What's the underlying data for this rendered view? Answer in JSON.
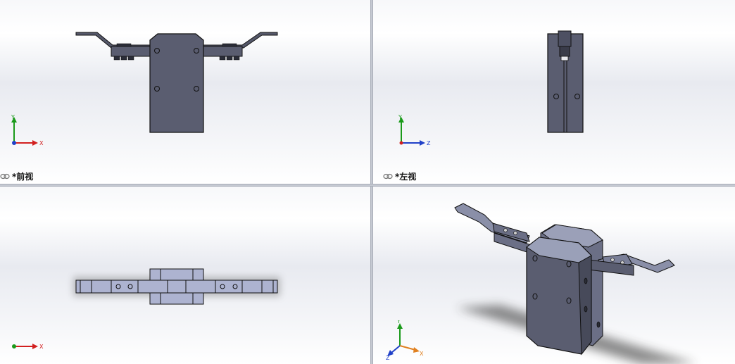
{
  "toolbar": {
    "items": [
      {
        "icon": "zoom-to-fit-icon",
        "dropdown": false
      },
      {
        "icon": "zoom-to-area-icon",
        "dropdown": false
      },
      {
        "icon": "previous-view-icon",
        "dropdown": false
      },
      {
        "icon": "section-view-icon",
        "dropdown": false
      },
      {
        "icon": "view-orientation-icon",
        "dropdown": true
      },
      {
        "icon": "display-style-icon",
        "dropdown": true
      },
      {
        "icon": "hide-show-items-icon",
        "dropdown": true
      },
      {
        "icon": "edit-appearance-icon",
        "dropdown": false
      },
      {
        "icon": "apply-scene-icon",
        "dropdown": true
      },
      {
        "icon": "view-settings-icon",
        "dropdown": true
      }
    ]
  },
  "viewports": {
    "front": {
      "label": "*前视",
      "triad": {
        "x": "X",
        "y": "Y"
      }
    },
    "left": {
      "label": "*左视",
      "triad": {
        "y": "Y",
        "z": "Z"
      }
    },
    "top": {
      "label": "",
      "triad": {
        "x": "X"
      }
    },
    "iso": {
      "label": "",
      "triad": {
        "x": "X",
        "y": "Y",
        "z": "Z"
      }
    }
  },
  "colors": {
    "part_fill": "#5a5d70",
    "part_edge": "#111111",
    "axis_x": "#d22020",
    "axis_y": "#1a9a1a",
    "axis_z": "#2040c8"
  }
}
